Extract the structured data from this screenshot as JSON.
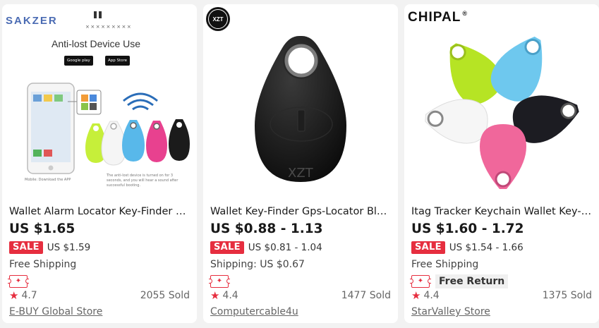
{
  "products": [
    {
      "title": "Wallet Alarm Locator Key-Finder Bluetooth",
      "price": "US $1.65",
      "sale_label": "SALE",
      "sale_price": "US $1.59",
      "shipping": "Free Shipping",
      "free_return": "",
      "rating": "4.7",
      "sold": "2055 Sold",
      "store": "E-BUY Global Store",
      "image": {
        "brand": "SAKZER",
        "headline": "Anti-lost Device Use",
        "google_play": "Google play",
        "app_store": "App Store",
        "caption": "Mobile: Download the APP",
        "note": "The anti-lost device is turned on for 3 seconds, and you will hear a sound after successful booting."
      }
    },
    {
      "title": "Wallet Key-Finder Gps-Locator Bluetooth",
      "price": "US $0.88 - 1.13",
      "sale_label": "SALE",
      "sale_price": "US $0.81 - 1.04",
      "shipping": "Shipping: US $0.67",
      "free_return": "",
      "rating": "4.4",
      "sold": "1477 Sold",
      "store": "Computercable4u",
      "image": {
        "brand": "XZT"
      }
    },
    {
      "title": "Itag Tracker Keychain Wallet Key-Finder",
      "price": "US $1.60 - 1.72",
      "sale_label": "SALE",
      "sale_price": "US $1.54 - 1.66",
      "shipping": "Free Shipping",
      "free_return": "Free Return",
      "rating": "4.4",
      "sold": "1375 Sold",
      "store": "StarValley Store",
      "image": {
        "brand": "CHIPAL",
        "brand_mark": "®"
      }
    }
  ],
  "colors": {
    "sale_red": "#e62e3f",
    "page_bg": "#f2f2f2",
    "card_bg": "#ffffff",
    "text_primary": "#191919",
    "text_secondary": "#666666"
  },
  "icons": {
    "star": "star-icon",
    "coupon": "coupon-icon"
  }
}
